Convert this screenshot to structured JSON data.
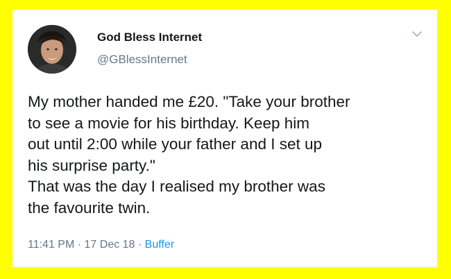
{
  "tweet": {
    "display_name": "God Bless Internet",
    "handle": "@GBlessInternet",
    "text": "My mother handed me £20. \"Take your brother\nto see a movie for his birthday. Keep him\nout until 2:00 while your father and I set up\nhis surprise party.\"\nThat was the day I realised my brother was\nthe favourite twin.",
    "time": "11:41 PM",
    "separator": " · ",
    "date": "17 Dec 18",
    "source": "Buffer"
  },
  "icons": {
    "menu": "chevron-down-icon",
    "avatar": "profile-photo"
  },
  "colors": {
    "background": "#ffff00",
    "card": "#ffffff",
    "text": "#14171a",
    "secondary": "#657786",
    "link": "#1b95e0"
  }
}
